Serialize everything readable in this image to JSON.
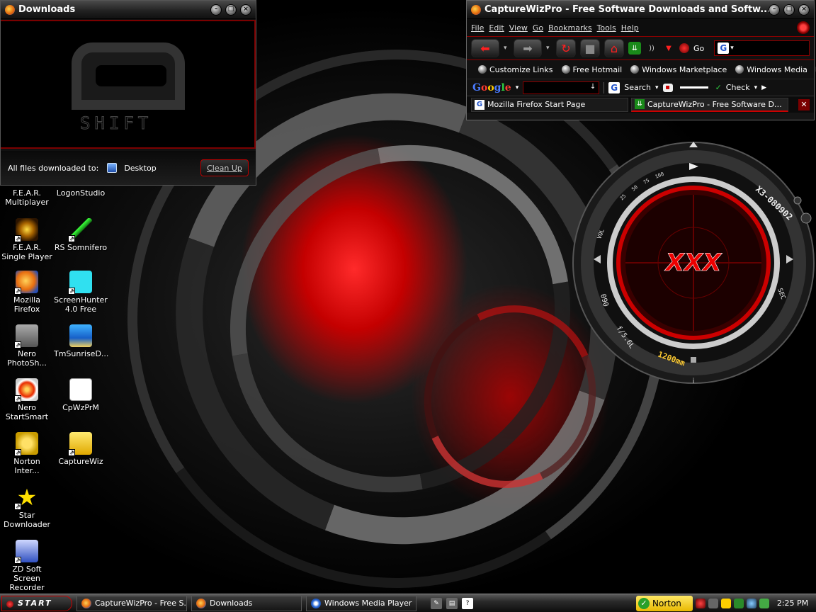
{
  "downloads_window": {
    "title": "Downloads",
    "all_files_label": "All files downloaded to:",
    "location": "Desktop",
    "cleanup_label": "Clean Up",
    "logo_text": "SHIFT"
  },
  "desktop_icons": [
    {
      "label": "F.E.A.R. Multiplayer",
      "icon": "fear-icon"
    },
    {
      "label": "LogonStudio",
      "icon": "logonstudio-icon"
    },
    {
      "label": "F.E.A.R. Single Player",
      "icon": "fear-icon"
    },
    {
      "label": "RS Somnifero",
      "icon": "syringe-icon"
    },
    {
      "label": "Mozilla Firefox",
      "icon": "firefox-icon"
    },
    {
      "label": "ScreenHunter 4.0 Free",
      "icon": "hand-icon"
    },
    {
      "label": "Nero PhotoSh...",
      "icon": "camera-icon"
    },
    {
      "label": "TmSunriseD...",
      "icon": "sunrise-icon"
    },
    {
      "label": "Nero StartSmart",
      "icon": "nero-icon"
    },
    {
      "label": "CpWzPrM",
      "icon": "document-icon"
    },
    {
      "label": "Norton Inter...",
      "icon": "norton-icon"
    },
    {
      "label": "CaptureWiz",
      "icon": "capturewiz-icon"
    },
    {
      "label": "Star Downloader",
      "icon": "star-icon"
    },
    {
      "label": "ZD Soft Screen Recorder",
      "icon": "monitor-icon"
    }
  ],
  "browser": {
    "title": "CaptureWizPro - Free Software Downloads and Softw...",
    "menu": [
      "File",
      "Edit",
      "View",
      "Go",
      "Bookmarks",
      "Tools",
      "Help"
    ],
    "go_label": "Go",
    "bookmarks": [
      "Customize Links",
      "Free Hotmail",
      "Windows Marketplace",
      "Windows Media"
    ],
    "google_toolbar": {
      "search_label": "Search",
      "check_label": "Check"
    },
    "tabs": [
      {
        "label": "Mozilla Firefox Start Page",
        "active": false
      },
      {
        "label": "CaptureWizPro - Free Software Dow...",
        "active": true
      }
    ]
  },
  "gadget": {
    "serial": "X3-080902",
    "focal": "1200mm",
    "aperture": "f/5.6L",
    "counter": "090",
    "side": "SEC",
    "vol": "VOL",
    "center_text": "XXX",
    "scale": [
      "25",
      "50",
      "75",
      "100"
    ]
  },
  "taskbar": {
    "start_label": "START",
    "buttons": [
      {
        "label": "CaptureWizPro - Free S...",
        "icon": "firefox-icon"
      },
      {
        "label": "Downloads",
        "icon": "firefox-icon"
      },
      {
        "label": "Windows Media Player",
        "icon": "wmp-icon"
      }
    ],
    "norton_label": "Norton",
    "clock": "2:25 PM"
  },
  "colors": {
    "accent": "#cc0000",
    "background": "#000000"
  }
}
